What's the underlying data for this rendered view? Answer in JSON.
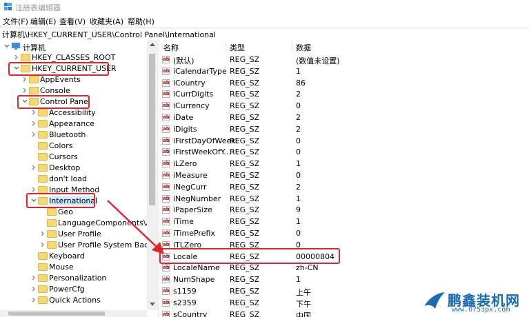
{
  "window": {
    "title": "注册表编辑器"
  },
  "menu": [
    "文件(F)",
    "编辑(E)",
    "查看(V)",
    "收藏夹(A)",
    "帮助(H)"
  ],
  "address": "计算机\\HKEY_CURRENT_USER\\Control Panel\\International",
  "tree": {
    "root": "计算机",
    "hkcr": "HKEY_CLASSES_ROOT",
    "hkcu": "HKEY_CURRENT_USER",
    "appevents": "AppEvents",
    "console": "Console",
    "control_panel": "Control Panel",
    "accessibility": "Accessibility",
    "appearance": "Appearance",
    "bluetooth": "Bluetooth",
    "colors": "Colors",
    "cursors": "Cursors",
    "desktop": "Desktop",
    "dontload": "don't load",
    "input_method": "Input Method",
    "international": "International",
    "geo": "Geo",
    "langcomp": "LanguageComponents\\Availa",
    "user_profile": "User Profile",
    "user_profile_backup": "User Profile System Backup",
    "keyboard": "Keyboard",
    "mouse": "Mouse",
    "personalization": "Personalization",
    "powercfg": "PowerCfg",
    "quick_actions": "Quick Actions"
  },
  "columns": {
    "name": "名称",
    "type": "类型",
    "data": "数据"
  },
  "rows": [
    {
      "name": "(默认)",
      "type": "REG_SZ",
      "data": "(数值未设置)"
    },
    {
      "name": "iCalendarType",
      "type": "REG_SZ",
      "data": "1"
    },
    {
      "name": "iCountry",
      "type": "REG_SZ",
      "data": "86"
    },
    {
      "name": "iCurrDigits",
      "type": "REG_SZ",
      "data": "2"
    },
    {
      "name": "iCurrency",
      "type": "REG_SZ",
      "data": "0"
    },
    {
      "name": "iDate",
      "type": "REG_SZ",
      "data": "2"
    },
    {
      "name": "iDigits",
      "type": "REG_SZ",
      "data": "2"
    },
    {
      "name": "iFirstDayOfWeek",
      "type": "REG_SZ",
      "data": "0"
    },
    {
      "name": "iFirstWeekOfY...",
      "type": "REG_SZ",
      "data": "0"
    },
    {
      "name": "iLZero",
      "type": "REG_SZ",
      "data": "1"
    },
    {
      "name": "iMeasure",
      "type": "REG_SZ",
      "data": "0"
    },
    {
      "name": "iNegCurr",
      "type": "REG_SZ",
      "data": "2"
    },
    {
      "name": "iNegNumber",
      "type": "REG_SZ",
      "data": "1"
    },
    {
      "name": "iPaperSize",
      "type": "REG_SZ",
      "data": "9"
    },
    {
      "name": "iTime",
      "type": "REG_SZ",
      "data": "1"
    },
    {
      "name": "iTimePrefix",
      "type": "REG_SZ",
      "data": "0"
    },
    {
      "name": "iTLZero",
      "type": "REG_SZ",
      "data": "0"
    },
    {
      "name": "Locale",
      "type": "REG_SZ",
      "data": "00000804"
    },
    {
      "name": "LocaleName",
      "type": "REG_SZ",
      "data": "zh-CN"
    },
    {
      "name": "NumShape",
      "type": "REG_SZ",
      "data": "1"
    },
    {
      "name": "s1159",
      "type": "REG_SZ",
      "data": "上午"
    },
    {
      "name": "s2359",
      "type": "REG_SZ",
      "data": "下午"
    },
    {
      "name": "sCountry",
      "type": "REG_SZ",
      "data": "中国"
    }
  ],
  "icon_glyph": "ab",
  "watermark": {
    "brand": "鹏鑫装机网",
    "url": "www.0753px.com"
  },
  "colors": {
    "highlight": "#e0242a",
    "folder": "#f7d774",
    "brand": "#1b6ab8"
  }
}
